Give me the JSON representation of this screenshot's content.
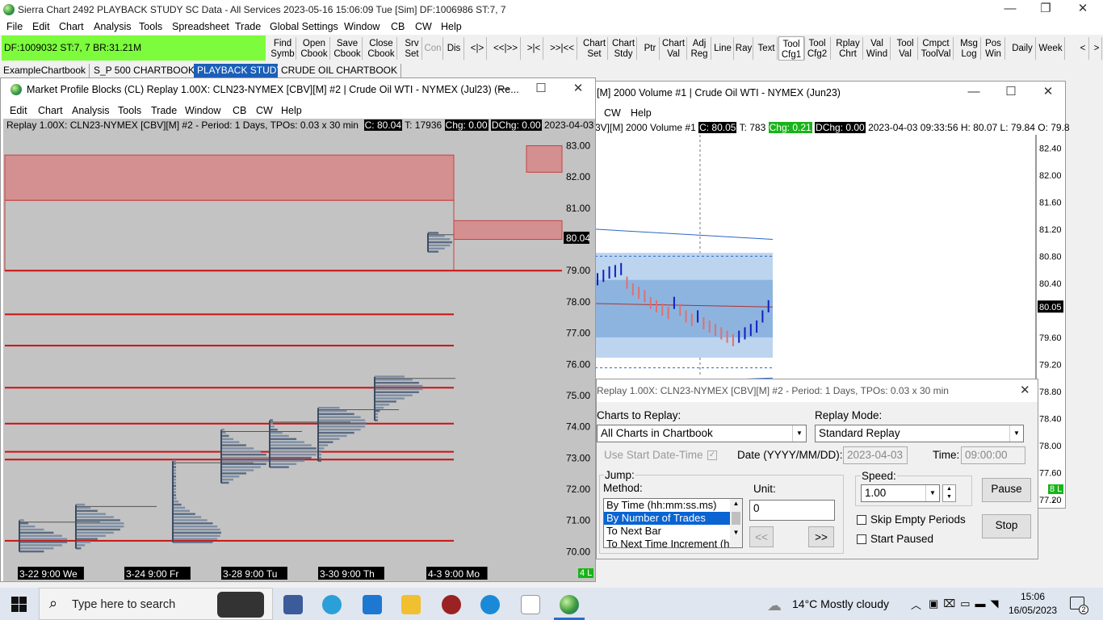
{
  "app": {
    "title": "Sierra Chart 2492 PLAYBACK STUDY  SC Data - All Services 2023-05-16  15:06:09 Tue [Sim]  DF:1006986  ST:7, 7",
    "menu": [
      "File",
      "Edit",
      "Chart",
      "Analysis",
      "Tools",
      "Spreadsheet",
      "Trade",
      "Global Settings",
      "Window",
      "CB",
      "CW",
      "Help"
    ]
  },
  "toolbar": {
    "status": "DF:1009032  ST:7, 7  BR:31.21M",
    "buttons": [
      {
        "label": "Find\nSymb"
      },
      {
        "label": "Open\nCbook"
      },
      {
        "label": "Save\nCbook"
      },
      {
        "label": "Close\nCbook"
      },
      {
        "label": "Srv\nSet"
      },
      {
        "label": "Con",
        "dim": true
      },
      {
        "label": "Dis"
      },
      {
        "label": "<|>"
      },
      {
        "label": "<<|>>"
      },
      {
        "label": ">|<"
      },
      {
        "label": ">>|<<"
      },
      {
        "label": "Chart\nSet"
      },
      {
        "label": "Chart\nStdy"
      },
      {
        "label": "Ptr"
      },
      {
        "label": "Chart\nVal"
      },
      {
        "label": "Adj\nReg"
      },
      {
        "label": "Line"
      },
      {
        "label": "Ray"
      },
      {
        "label": "Text"
      },
      {
        "label": "Tool\nCfg1"
      },
      {
        "label": "Tool\nCfg2"
      },
      {
        "label": "Rplay\nChrt"
      },
      {
        "label": "Val\nWind"
      },
      {
        "label": "Tool\nVal"
      },
      {
        "label": "Cmpct\nToolVal"
      },
      {
        "label": "Msg\nLog"
      },
      {
        "label": "Pos\nWin"
      },
      {
        "label": "Daily"
      },
      {
        "label": "Week"
      },
      {
        "label": "<"
      },
      {
        "label": ">"
      }
    ]
  },
  "tabs": [
    {
      "label": "ExampleChartbook"
    },
    {
      "label": "S_P 500 CHARTBOOK"
    },
    {
      "label": "PLAYBACK STUDY",
      "active": true
    },
    {
      "label": "CRUDE OIL CHARTBOOK"
    }
  ],
  "left_window": {
    "title": "Market Profile Blocks (CL) Replay 1.00X: CLN23-NYMEX [CBV][M]  #2 | Crude Oil WTI - NYMEX (Jul23) (Re...",
    "menu": [
      "Edit",
      "Chart",
      "Analysis",
      "Tools",
      "Trade",
      "Window",
      "CB",
      "CW",
      "Help"
    ],
    "info": "Replay 1.00X: CLN23-NYMEX [CBV][M]  #2 - Period: 1 Days, TPOs: 0.03 x 30 min",
    "c": "C: 80.04",
    "t": "T: 17936",
    "chg": "Chg: 0.00",
    "dchg": "DChg: 0.00",
    "date": "2023-04-03",
    "price_tag": "80.04",
    "corner": "4 L"
  },
  "right_window": {
    "title": "[M]  2000 Volume  #1 | Crude Oil WTI - NYMEX (Jun23)",
    "menu": [
      "CW",
      "Help"
    ],
    "info_prefix": "3V][M]  2000 Volume  #1",
    "c": "C: 80.05",
    "t": "T: 783",
    "chg": "Chg: 0.21",
    "dchg": "DChg: 0.00",
    "info_rest": "2023-04-03 09:33:56  H: 80.07  L: 79.84  O: 79.8",
    "price_tag": "80.05",
    "corner": "8 L"
  },
  "chart_data": [
    {
      "type": "market-profile",
      "y_ticks": [
        "83.00",
        "82.00",
        "81.00",
        "80.04",
        "79.00",
        "78.00",
        "77.00",
        "76.00",
        "75.00",
        "74.00",
        "73.00",
        "72.00",
        "71.00",
        "70.00"
      ],
      "x_labels": [
        "3-22  9:00 We",
        "3-24  9:00 Fr",
        "3-28  9:00 Tu",
        "3-30  9:00 Th",
        "4-3  9:00 Mo"
      ],
      "poc_lines": [
        79.0,
        77.6,
        76.6,
        75.25,
        74.1,
        73.2,
        72.95,
        70.35
      ],
      "ylim": [
        69.7,
        83.4
      ],
      "days": [
        {
          "low": 70.0,
          "high": 71.0,
          "poc": 70.35
        },
        {
          "low": 70.1,
          "high": 71.5,
          "poc": 70.85
        },
        {
          "low": 70.3,
          "high": 72.9,
          "poc": 70.6
        },
        {
          "low": 72.2,
          "high": 73.9,
          "poc": 72.95
        },
        {
          "low": 72.7,
          "high": 74.2,
          "poc": 73.2
        },
        {
          "low": 72.9,
          "high": 74.6,
          "poc": 74.1
        },
        {
          "low": 74.2,
          "high": 75.6,
          "poc": 75.25
        },
        {
          "low": 79.6,
          "high": 80.2,
          "poc": 79.9
        }
      ]
    },
    {
      "type": "line",
      "y_ticks": [
        "82.40",
        "82.00",
        "81.60",
        "81.20",
        "80.80",
        "80.40",
        "80.05",
        "79.60",
        "79.20",
        "78.80",
        "78.40",
        "78.00",
        "77.60",
        "77.20"
      ],
      "ylim": [
        77.2,
        82.5
      ],
      "x": [
        1,
        2,
        3,
        4,
        5,
        6,
        7,
        8,
        9,
        10,
        11,
        12,
        13,
        14,
        15,
        16,
        17,
        18,
        19,
        20,
        21,
        22,
        23,
        24,
        25,
        26,
        27,
        28,
        29,
        30
      ],
      "values": [
        80.45,
        80.5,
        80.55,
        80.57,
        80.6,
        80.4,
        80.3,
        80.25,
        80.2,
        80.1,
        80.05,
        80.0,
        79.95,
        80.1,
        80.0,
        79.9,
        79.85,
        79.9,
        79.8,
        79.75,
        79.7,
        79.65,
        79.6,
        79.55,
        79.6,
        79.65,
        79.7,
        79.75,
        79.9,
        80.05
      ]
    }
  ],
  "replay_dialog": {
    "title": "Replay 1.00X: CLN23-NYMEX [CBV][M]  #2 - Period: 1 Days, TPOs: 0.03 x 30 min",
    "charts_label": "Charts to Replay:",
    "charts_value": "All Charts in Chartbook",
    "mode_label": "Replay Mode:",
    "mode_value": "Standard Replay",
    "use_start": "Use Start Date-Time",
    "date_label": "Date (YYYY/MM/DD):",
    "date_value": "2023-04-03",
    "time_label": "Time:",
    "time_value": "09:00:00",
    "jump_label": "Jump:",
    "method_label": "Method:",
    "methods": [
      "By Time (hh:mm:ss.ms)",
      "By Number of Trades",
      "To Next Bar",
      "To Next Time Increment (h"
    ],
    "unit_label": "Unit:",
    "unit_value": "0",
    "back_btn": "<<",
    "fwd_btn": ">>",
    "speed_label": "Speed:",
    "speed_value": "1.00",
    "pause_btn": "Pause",
    "stop_btn": "Stop",
    "skip_empty": "Skip Empty Periods",
    "start_paused": "Start Paused"
  },
  "taskbar": {
    "search_placeholder": "Type here to search",
    "weather": "14°C  Mostly cloudy",
    "time": "15:06",
    "date": "16/05/2023",
    "notif": "2"
  }
}
